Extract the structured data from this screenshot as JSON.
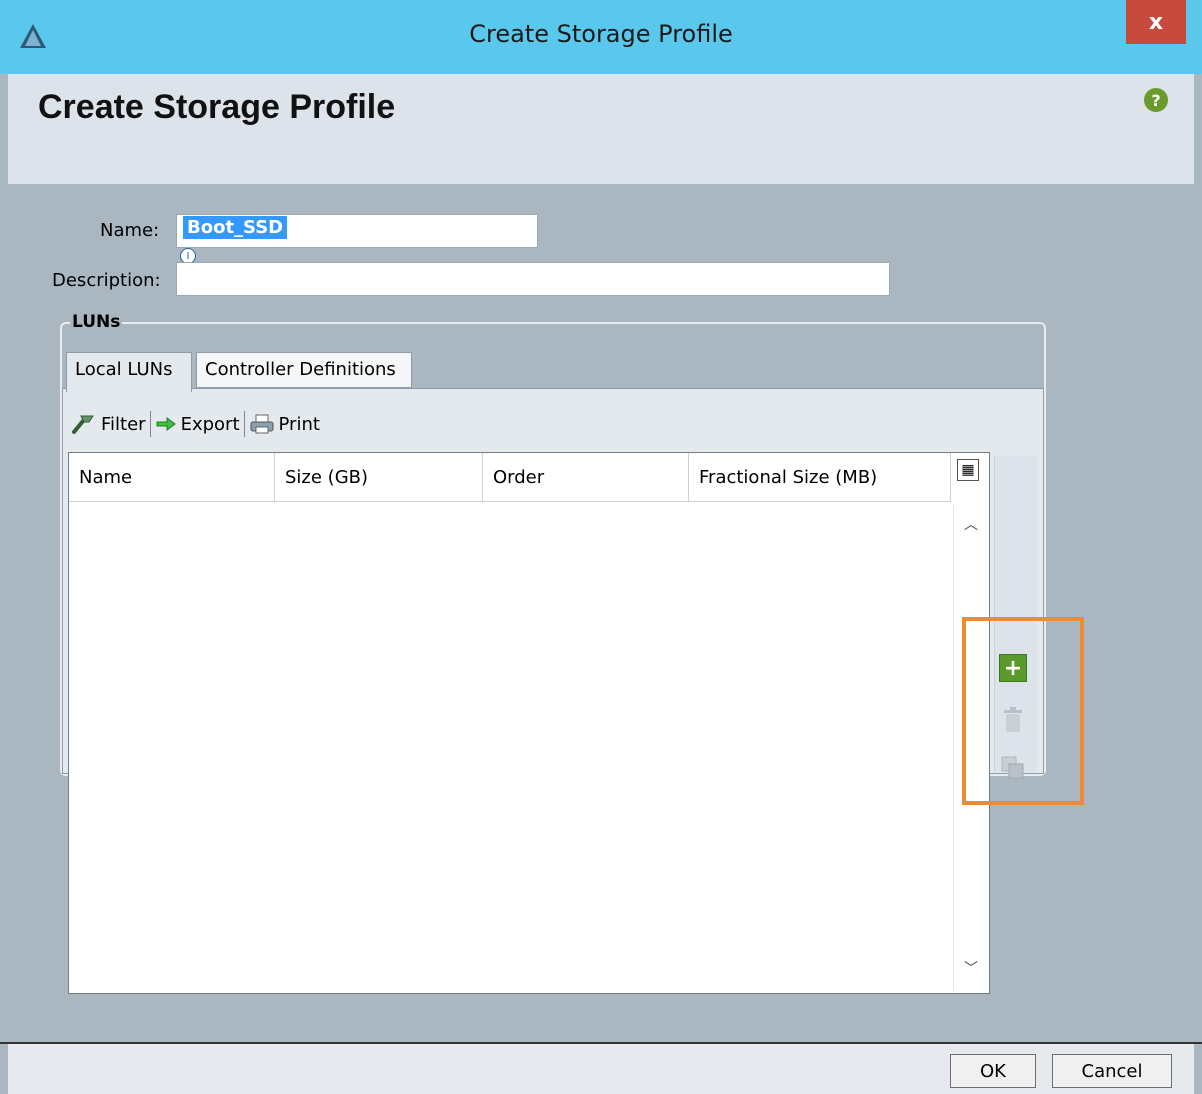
{
  "window": {
    "title": "Create Storage Profile",
    "close_label": "x"
  },
  "header": {
    "title": "Create Storage Profile",
    "help_label": "?"
  },
  "form": {
    "name_label": "Name:",
    "name_value": "Boot_SSD",
    "description_label": "Description:",
    "description_value": ""
  },
  "luns": {
    "group_label": "LUNs",
    "tabs": [
      {
        "label": "Local LUNs",
        "active": true
      },
      {
        "label": "Controller Definitions",
        "active": false
      }
    ],
    "toolbar": {
      "filter": "Filter",
      "export": "Export",
      "print": "Print"
    },
    "columns": [
      "Name",
      "Size (GB)",
      "Order",
      "Fractional Size (MB)"
    ],
    "rows": [],
    "actions": [
      "add-icon",
      "delete-icon",
      "clone-icon"
    ]
  },
  "footer": {
    "ok": "OK",
    "cancel": "Cancel"
  },
  "colors": {
    "titlebar": "#5ac8ed",
    "close": "#c74b3c",
    "accent": "#f08a30",
    "add": "#5a9a2a"
  }
}
